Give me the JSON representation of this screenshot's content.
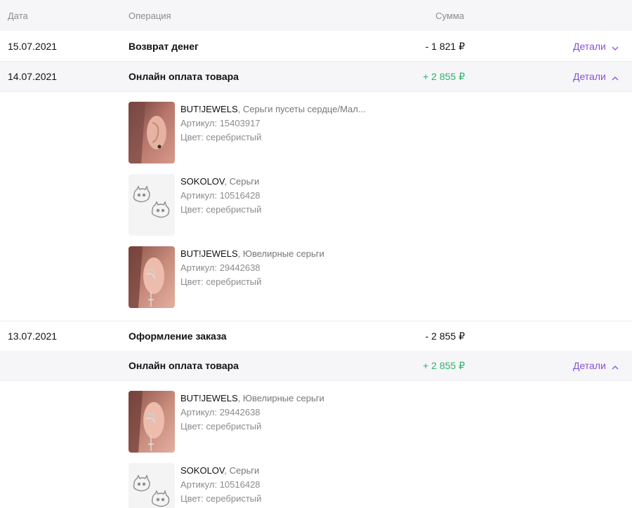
{
  "header": {
    "date_label": "Дата",
    "operation_label": "Операция",
    "amount_label": "Сумма"
  },
  "rows": [
    {
      "date": "15.07.2021",
      "operation": "Возврат денег",
      "amount": "- 1 821 ₽",
      "details": "Детали",
      "details_icon": "chevron-down-icon"
    },
    {
      "date": "14.07.2021",
      "operation": "Онлайн оплата товара",
      "amount": "+ 2 855 ₽",
      "details": "Детали",
      "details_icon": "chevron-up-icon",
      "items": [
        {
          "brand": "BUT!JEWELS",
          "name": ", Серьги пусеты сердце/Мал...",
          "article": "Артикул: 15403917",
          "color": "Цвет: серебристый",
          "image": "earring-heart-photo"
        },
        {
          "brand": "SOKOLOV",
          "name": ", Серьги",
          "article": "Артикул: 10516428",
          "color": "Цвет: серебристый",
          "image": "cat-earrings-photo"
        },
        {
          "brand": "BUT!JEWELS",
          "name": ", Ювелирные серьги",
          "article": "Артикул: 29442638",
          "color": "Цвет: серебристый",
          "image": "ear-cuff-cross-photo"
        }
      ]
    },
    {
      "date": "13.07.2021",
      "operation": "Оформление заказа",
      "amount": "- 2 855 ₽"
    },
    {
      "date": "",
      "operation": "Онлайн оплата товара",
      "amount": "+ 2 855 ₽",
      "details": "Детали",
      "details_icon": "chevron-up-icon",
      "items": [
        {
          "brand": "BUT!JEWELS",
          "name": ", Ювелирные серьги",
          "article": "Артикул: 29442638",
          "color": "Цвет: серебристый",
          "image": "ear-cuff-cross-photo"
        },
        {
          "brand": "SOKOLOV",
          "name": ", Серьги",
          "article": "Артикул: 10516428",
          "color": "Цвет: серебристый",
          "image": "cat-earrings-photo"
        }
      ]
    }
  ],
  "colors": {
    "accent": "#8a4fd8",
    "positive": "#2fb36b",
    "header_bg": "#f6f6f8"
  }
}
